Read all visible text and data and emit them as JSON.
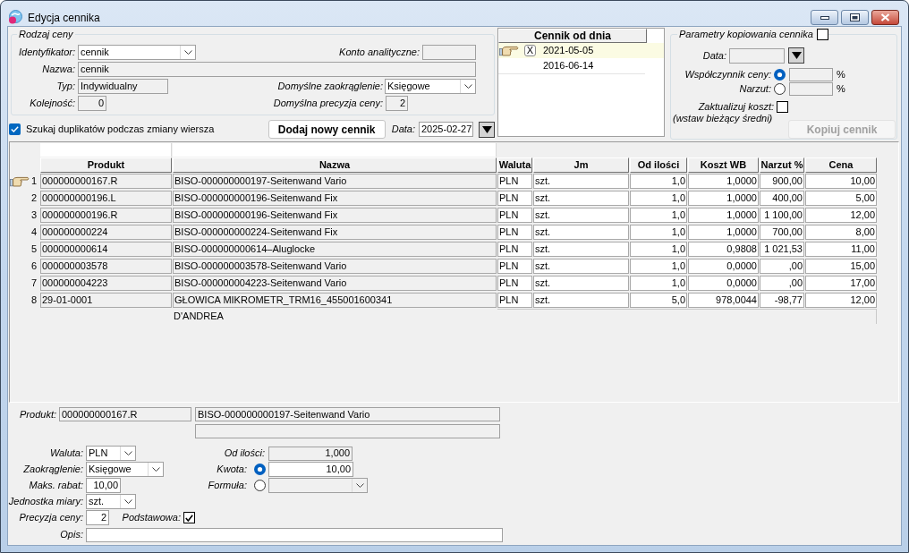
{
  "window": {
    "title": "Edycja cennika"
  },
  "price_type": {
    "legend": "Rodzaj ceny",
    "identifier": {
      "label": "Identyfikator:",
      "value": "cennik"
    },
    "analytic_account": {
      "label": "Konto analityczne:"
    },
    "name": {
      "label": "Nazwa:",
      "value": "cennik"
    },
    "type": {
      "label": "Typ:",
      "value": "Indywidualny"
    },
    "default_rounding": {
      "label": "Domyślne zaokrąglenie:",
      "value": "Księgowe"
    },
    "order": {
      "label": "Kolejność:",
      "value": "0"
    },
    "default_precision": {
      "label": "Domyślna precyzja ceny:",
      "value": "2"
    }
  },
  "duplicate_search": {
    "label": "Szukaj duplikatów podczas zmiany wiersza",
    "checked": true
  },
  "add_button": {
    "label": "Dodaj nowy cennik"
  },
  "date": {
    "label": "Data:",
    "value": "2025-02-27"
  },
  "price_lists": {
    "heading": "Cennik od dnia",
    "items": [
      {
        "date": "2021-05-05",
        "mark": "X",
        "selected": true
      },
      {
        "date": "2016-06-14",
        "selected": false
      }
    ]
  },
  "copy_params": {
    "legend": "Parametry kopiowania cennika",
    "checked": false,
    "date": {
      "label": "Data:"
    },
    "factor": {
      "label": "Współczynnik ceny:",
      "selected": true,
      "unit": "%"
    },
    "markup": {
      "label": "Narzut:",
      "selected": false,
      "unit": "%"
    },
    "update_cost": {
      "label": "Zaktualizuj koszt:",
      "checked": false
    },
    "note": "(wstaw bieżący średni)",
    "copy_button": {
      "label": "Kopiuj cennik",
      "disabled": true
    }
  },
  "table": {
    "columns": [
      "Produkt",
      "Nazwa",
      "Waluta",
      "Jm",
      "Od ilości",
      "Koszt WB",
      "Narzut %",
      "Cena"
    ],
    "rows": [
      {
        "number": "1",
        "current": true,
        "cells": [
          "000000000167.R",
          "BISO-000000000197-Seitenwand Vario",
          "PLN",
          "szt.",
          "1,0",
          "1,0000",
          "900,00",
          "10,00"
        ]
      },
      {
        "number": "2",
        "current": false,
        "cells": [
          "000000000196.L",
          "BISO-000000000196-Seitenwand Fix",
          "PLN",
          "szt.",
          "1,0",
          "1,0000",
          "400,00",
          "5,00"
        ]
      },
      {
        "number": "3",
        "current": false,
        "cells": [
          "000000000196.R",
          "BISO-000000000196-Seitenwand Fix",
          "PLN",
          "szt.",
          "1,0",
          "1,0000",
          "1 100,00",
          "12,00"
        ]
      },
      {
        "number": "4",
        "current": false,
        "cells": [
          "000000000224",
          "BISO-000000000224-Seitenwand Fix",
          "PLN",
          "szt.",
          "1,0",
          "1,0000",
          "700,00",
          "8,00"
        ]
      },
      {
        "number": "5",
        "current": false,
        "cells": [
          "000000000614",
          "BISO-000000000614–Aluglocke",
          "PLN",
          "szt.",
          "1,0",
          "0,9808",
          "1 021,53",
          "11,00"
        ]
      },
      {
        "number": "6",
        "current": false,
        "cells": [
          "000000003578",
          "BISO-000000003578-Seitenwand Vario",
          "PLN",
          "szt.",
          "1,0",
          "0,0000",
          ",00",
          "15,00"
        ]
      },
      {
        "number": "7",
        "current": false,
        "cells": [
          "000000004223",
          "BISO-000000004223-Seitenwand Vario",
          "PLN",
          "szt.",
          "1,0",
          "0,0000",
          ",00",
          "17,00"
        ]
      },
      {
        "number": "8",
        "current": false,
        "cells": [
          "29-01-0001",
          "GŁOWICA MIKROMETR_TRM16_455001600341",
          "PLN",
          "szt.",
          "5,0",
          "978,0044",
          "-98,77",
          "12,00"
        ]
      }
    ],
    "continuation": "D'ANDREA"
  },
  "detail": {
    "product": {
      "label": "Produkt:",
      "code": "000000000167.R",
      "name": "BISO-000000000197-Seitenwand Vario"
    },
    "currency": {
      "label": "Waluta:",
      "value": "PLN"
    },
    "rounding": {
      "label": "Zaokrąglenie:",
      "value": "Księgowe"
    },
    "max_discount": {
      "label": "Maks. rabat:",
      "value": "10,00"
    },
    "unit": {
      "label": "Jednostka miary:",
      "value": "szt."
    },
    "precision": {
      "label": "Precyzja ceny:",
      "value": "2"
    },
    "basic": {
      "label": "Podstawowa:",
      "checked": true
    },
    "description": {
      "label": "Opis:"
    },
    "from_qty": {
      "label": "Od ilości:",
      "value": "1,000"
    },
    "amount": {
      "label": "Kwota:",
      "selected": true,
      "value": "10,00"
    },
    "formula": {
      "label": "Formuła:",
      "selected": false
    }
  }
}
